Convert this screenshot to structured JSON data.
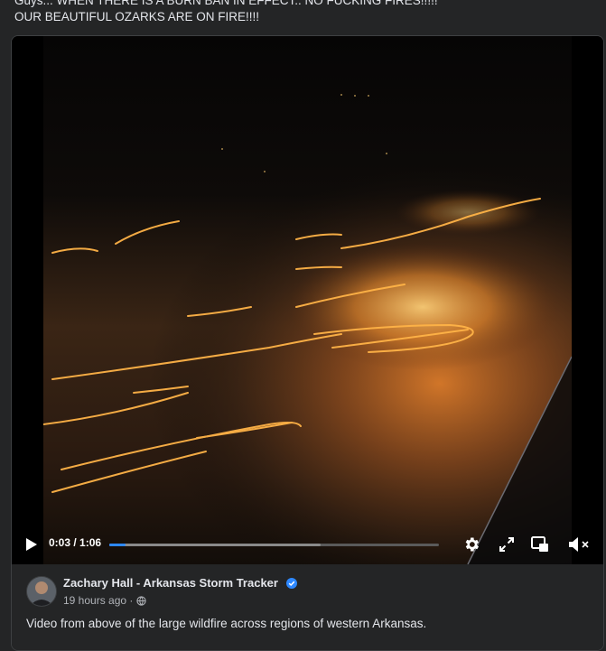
{
  "post": {
    "text_line1": "Guys... WHEN THERE IS A BURN BAN IN EFFECT.. NO FUCKING FIRES!!!!!",
    "text_line2": "OUR BEAUTIFUL OZARKS ARE ON FIRE!!!!"
  },
  "video": {
    "current_time": "0:03",
    "duration": "1:06",
    "time_display": "0:03 / 1:06",
    "progress_fraction": 0.048,
    "buffered_fraction": 0.64
  },
  "shared_post": {
    "author": "Zachary Hall - Arkansas Storm Tracker",
    "verified": true,
    "time_ago": "19 hours ago",
    "separator": "·",
    "caption": "Video from above of the large wildfire across regions of western Arkansas."
  },
  "icons": {
    "play": "play-icon",
    "settings": "gear-icon",
    "fullscreen": "fullscreen-icon",
    "pip": "picture-in-picture-icon",
    "volume": "muted-volume-icon",
    "audience": "globe-icon"
  },
  "colors": {
    "background": "#242526",
    "progress": "#2d88ff",
    "verified": "#2d88ff"
  }
}
